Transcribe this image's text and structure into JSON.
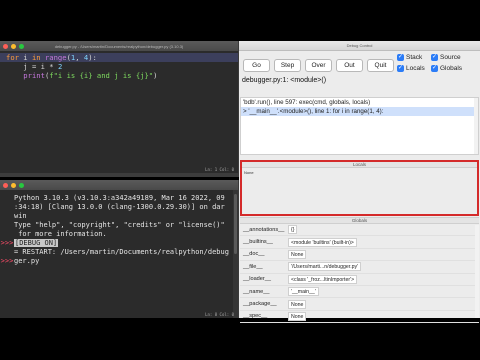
{
  "editor": {
    "title": "debugger.py - /Users/martin/Documents/realpython/debugger.py (3.10.3)",
    "status": "Ln: 1  Col: 0",
    "lines": [
      [
        {
          "c": "kw",
          "t": "for"
        },
        {
          "c": "nm",
          "t": " i "
        },
        {
          "c": "kw",
          "t": "in"
        },
        {
          "c": "bi",
          "t": " range"
        },
        {
          "c": "nm",
          "t": "("
        },
        {
          "c": "num",
          "t": "1"
        },
        {
          "c": "nm",
          "t": ", "
        },
        {
          "c": "num",
          "t": "4"
        },
        {
          "c": "nm",
          "t": "):"
        }
      ],
      [
        {
          "c": "nm",
          "t": "    j = i * "
        },
        {
          "c": "num",
          "t": "2"
        }
      ],
      [
        {
          "c": "bi",
          "t": "    print"
        },
        {
          "c": "nm",
          "t": "("
        },
        {
          "c": "str",
          "t": "f\"i is {i} and j is {j}\""
        },
        {
          "c": "nm",
          "t": ")"
        }
      ]
    ]
  },
  "shell": {
    "status": "Ln: 8  Col: 0",
    "gutter": [
      "",
      "",
      "",
      "",
      "",
      ">>>",
      "",
      ">>>",
      "",
      ""
    ],
    "lines": [
      "Python 3.10.3 (v3.10.3:a342a49189, Mar 16 2022, 09",
      ":34:18) [Clang 13.0.0 (clang-1300.0.29.30)] on dar",
      "win",
      "Type \"help\", \"copyright\", \"credits\" or \"license()\"",
      " for more information.",
      "",
      "",
      "= RESTART: /Users/martin/Documents/realpython/debug",
      "ger.py"
    ],
    "debug_tag": "[DEBUG ON]"
  },
  "debugger": {
    "title": "Debug Control",
    "buttons": {
      "go": "Go",
      "step": "Step",
      "over": "Over",
      "out": "Out",
      "quit": "Quit"
    },
    "checks": {
      "stack": "Stack",
      "source": "Source",
      "locals": "Locals",
      "globals": "Globals"
    },
    "status": "debugger.py:1: <module>()",
    "stack": [
      "'bdb'.run(), line 597: exec(cmd, globals, locals)",
      "> '__main__'.<module>(), line 1: for i in range(1, 4):"
    ],
    "locals_title": "Locals",
    "locals_value": "None",
    "globals_title": "Globals",
    "globals": [
      {
        "k": "__annotations__",
        "v": "{}"
      },
      {
        "k": "__builtins__",
        "v": "<module 'builtins' (built-in)>"
      },
      {
        "k": "__doc__",
        "v": "None"
      },
      {
        "k": "__file__",
        "v": "'/Users/marti...n/debugger.py'"
      },
      {
        "k": "__loader__",
        "v": "<class '_froz...ltinImporter'>"
      },
      {
        "k": "__name__",
        "v": "'__main__'"
      },
      {
        "k": "__package__",
        "v": "None"
      },
      {
        "k": "__spec__",
        "v": "None"
      }
    ]
  }
}
